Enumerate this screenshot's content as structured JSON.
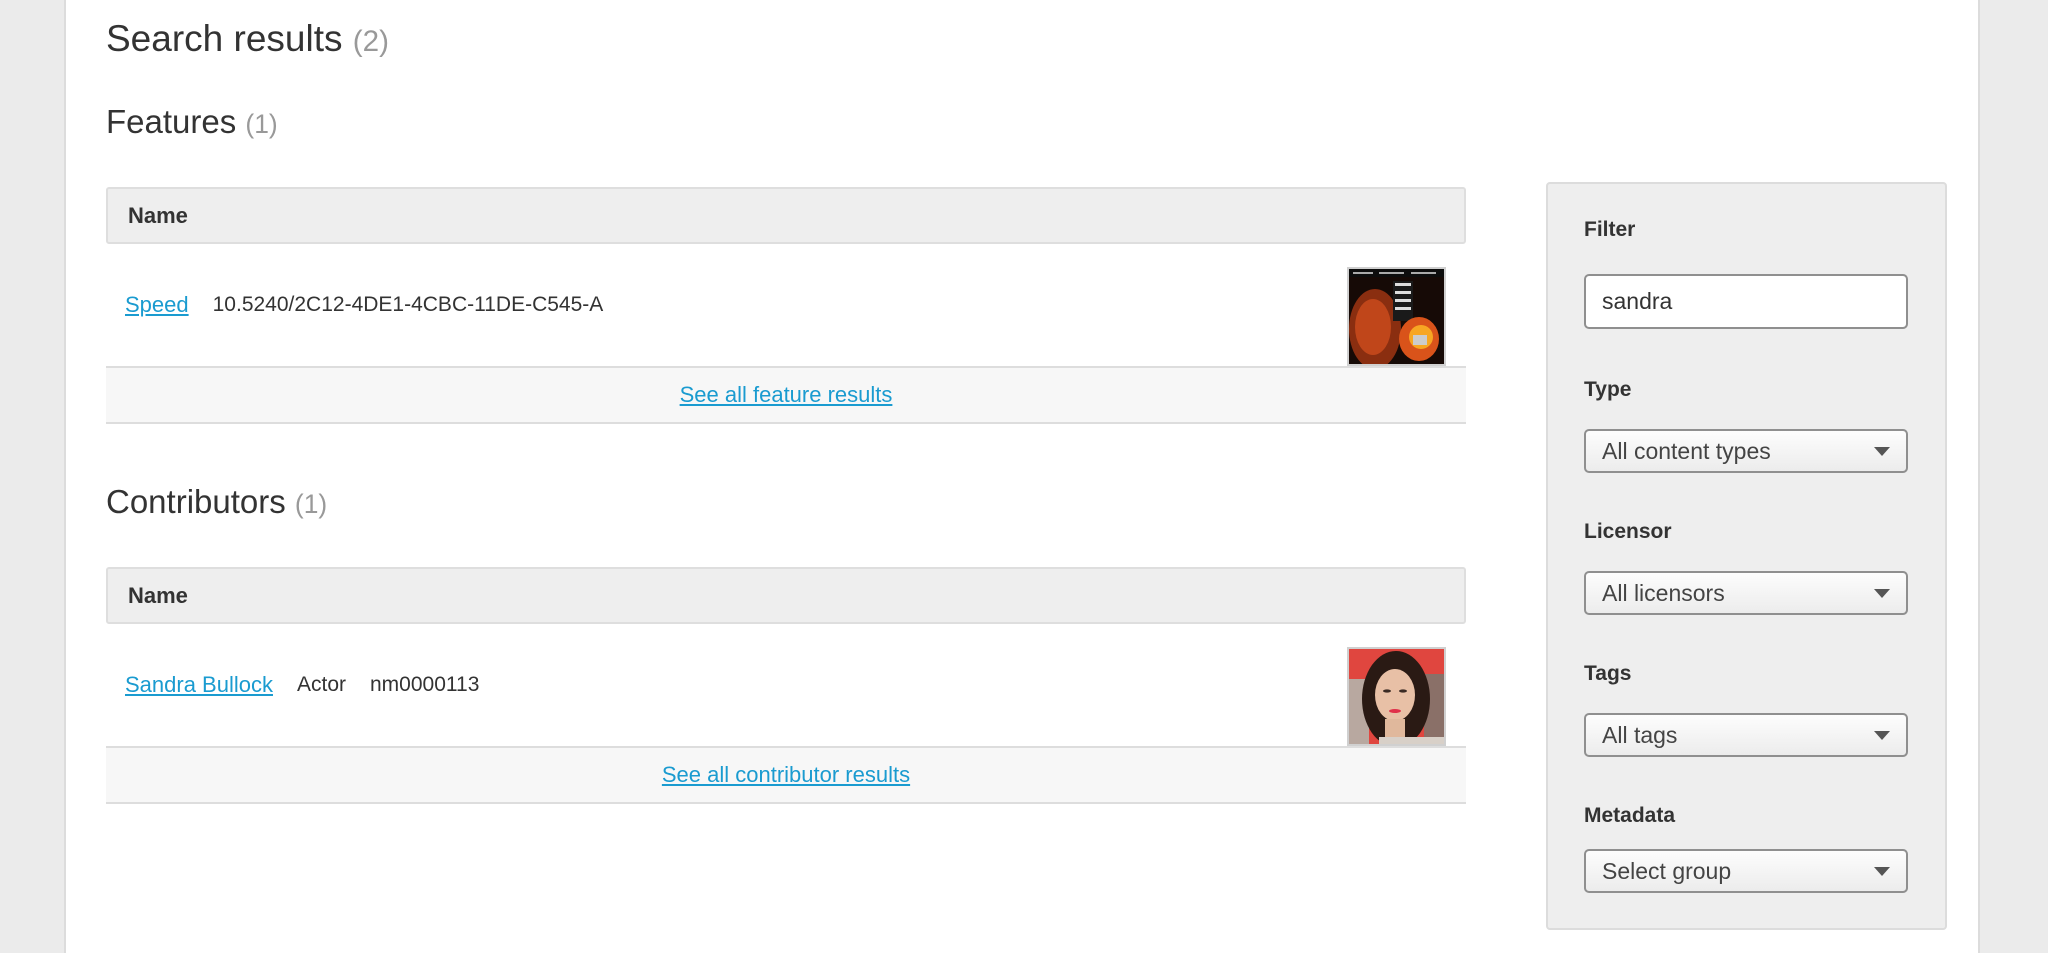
{
  "header": {
    "title": "Search results",
    "count": "(2)"
  },
  "features": {
    "title": "Features",
    "count": "(1)",
    "column_header": "Name",
    "rows": [
      {
        "name": "Speed",
        "identifier": "10.5240/2C12-4DE1-4CBC-11DE-C545-A",
        "thumbnail": "movie-poster-image"
      }
    ],
    "see_all_label": "See all feature results"
  },
  "contributors": {
    "title": "Contributors",
    "count": "(1)",
    "column_header": "Name",
    "rows": [
      {
        "name": "Sandra Bullock",
        "role": "Actor",
        "identifier": "nm0000113",
        "thumbnail": "person-photo-image"
      }
    ],
    "see_all_label": "See all contributor results"
  },
  "filter": {
    "filter_label": "Filter",
    "filter_value": "sandra",
    "type_label": "Type",
    "type_value": "All content types",
    "licensor_label": "Licensor",
    "licensor_value": "All licensors",
    "tags_label": "Tags",
    "tags_value": "All tags",
    "metadata_label": "Metadata",
    "metadata_value": "Select group"
  },
  "colors": {
    "link": "#1a9bd0",
    "background": "#ebebeb",
    "panel": "#eeeeee"
  }
}
